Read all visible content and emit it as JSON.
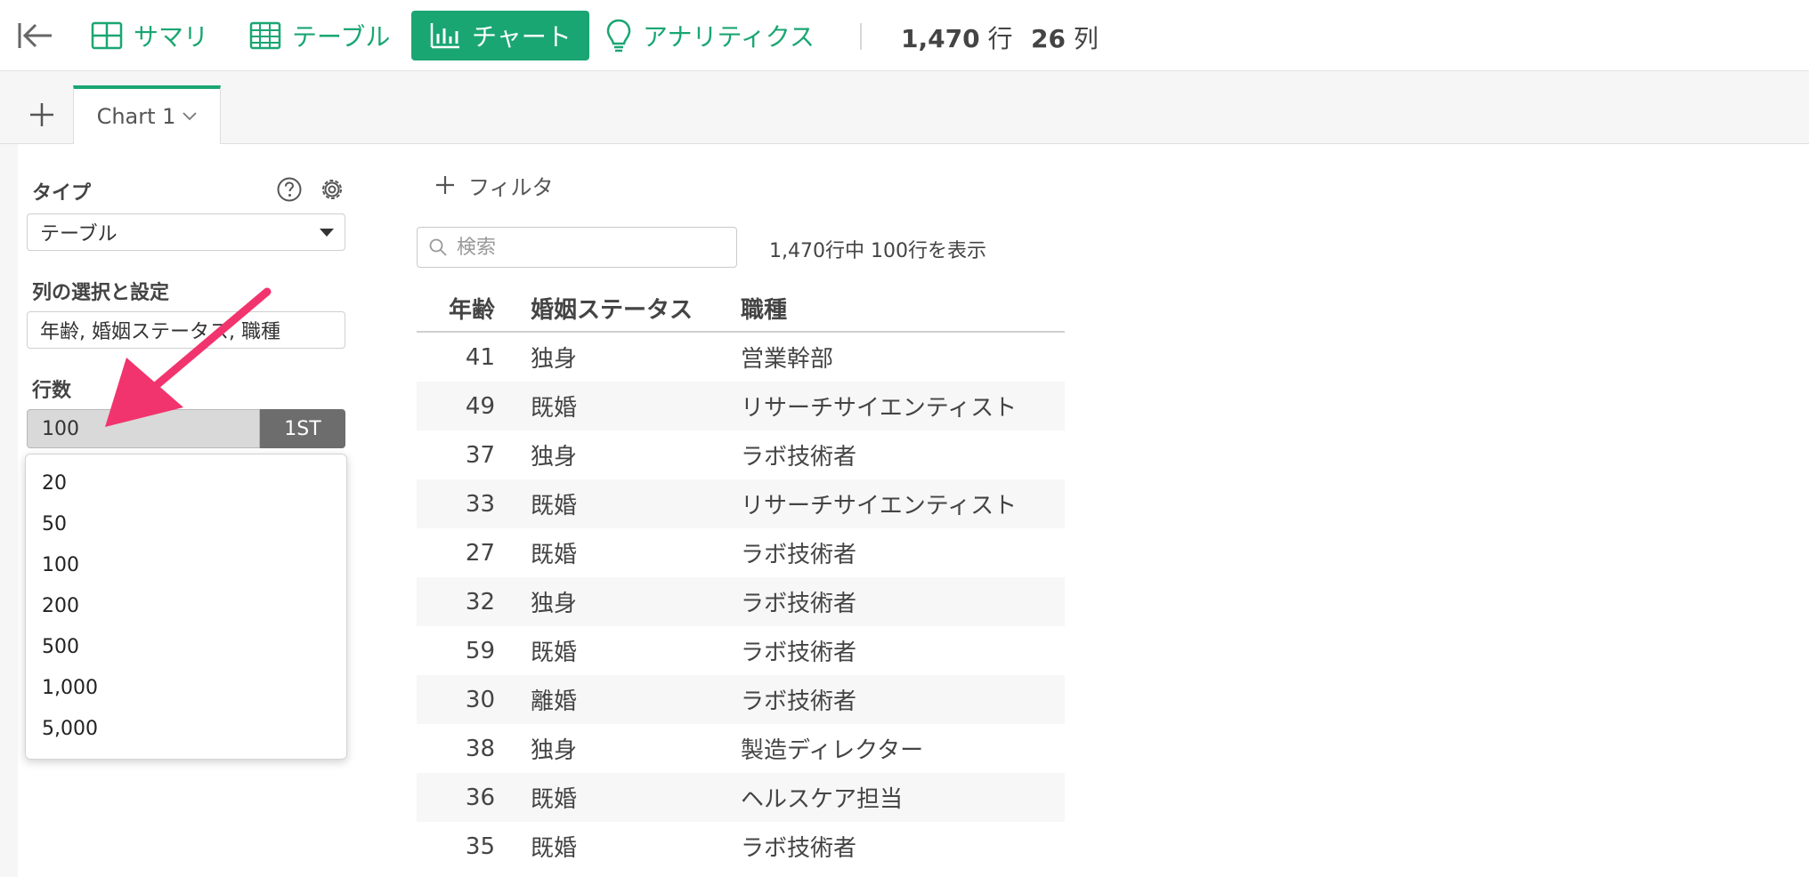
{
  "toolbar": {
    "summary": "サマリ",
    "table": "テーブル",
    "chart": "チャート",
    "analytics": "アナリティクス",
    "rows_count": "1,470",
    "rows_unit": "行",
    "cols_count": "26",
    "cols_unit": "列",
    "accent_color": "#1aa672"
  },
  "tabs": {
    "chart_tab": "Chart 1"
  },
  "panel": {
    "type_label": "タイプ",
    "type_value": "テーブル",
    "columns_label": "列の選択と設定",
    "columns_value": "年齢, 婚姻ステータス, 職種",
    "rows_label": "行数",
    "rows_value": "100",
    "first_button": "1ST",
    "row_options": [
      "20",
      "50",
      "100",
      "200",
      "500",
      "1,000",
      "5,000"
    ]
  },
  "main": {
    "filter_label": "フィルタ",
    "search_placeholder": "検索",
    "showing_text": "1,470行中 100行を表示",
    "table": {
      "headers": [
        "年齢",
        "婚姻ステータス",
        "職種"
      ],
      "rows": [
        [
          "41",
          "独身",
          "営業幹部"
        ],
        [
          "49",
          "既婚",
          "リサーチサイエンティスト"
        ],
        [
          "37",
          "独身",
          "ラボ技術者"
        ],
        [
          "33",
          "既婚",
          "リサーチサイエンティスト"
        ],
        [
          "27",
          "既婚",
          "ラボ技術者"
        ],
        [
          "32",
          "独身",
          "ラボ技術者"
        ],
        [
          "59",
          "既婚",
          "ラボ技術者"
        ],
        [
          "30",
          "離婚",
          "ラボ技術者"
        ],
        [
          "38",
          "独身",
          "製造ディレクター"
        ],
        [
          "36",
          "既婚",
          "ヘルスケア担当"
        ],
        [
          "35",
          "既婚",
          "ラボ技術者"
        ]
      ]
    }
  },
  "annotation": {
    "arrow_color": "#f2346e"
  }
}
